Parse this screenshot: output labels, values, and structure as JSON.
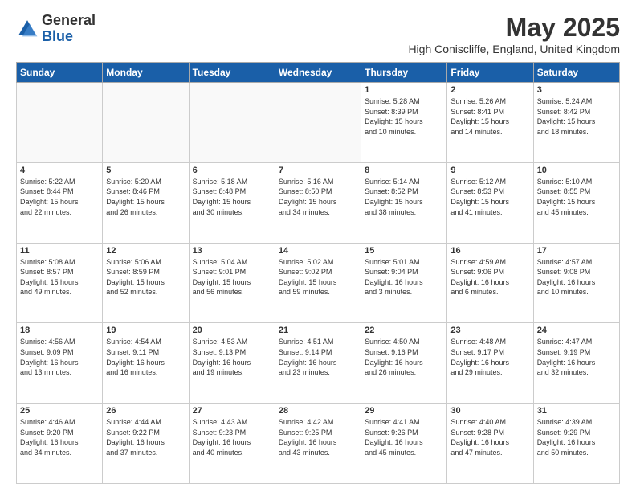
{
  "header": {
    "logo_general": "General",
    "logo_blue": "Blue",
    "month_title": "May 2025",
    "location": "High Coniscliffe, England, United Kingdom"
  },
  "days_of_week": [
    "Sunday",
    "Monday",
    "Tuesday",
    "Wednesday",
    "Thursday",
    "Friday",
    "Saturday"
  ],
  "weeks": [
    [
      {
        "day": "",
        "info": ""
      },
      {
        "day": "",
        "info": ""
      },
      {
        "day": "",
        "info": ""
      },
      {
        "day": "",
        "info": ""
      },
      {
        "day": "1",
        "info": "Sunrise: 5:28 AM\nSunset: 8:39 PM\nDaylight: 15 hours\nand 10 minutes."
      },
      {
        "day": "2",
        "info": "Sunrise: 5:26 AM\nSunset: 8:41 PM\nDaylight: 15 hours\nand 14 minutes."
      },
      {
        "day": "3",
        "info": "Sunrise: 5:24 AM\nSunset: 8:42 PM\nDaylight: 15 hours\nand 18 minutes."
      }
    ],
    [
      {
        "day": "4",
        "info": "Sunrise: 5:22 AM\nSunset: 8:44 PM\nDaylight: 15 hours\nand 22 minutes."
      },
      {
        "day": "5",
        "info": "Sunrise: 5:20 AM\nSunset: 8:46 PM\nDaylight: 15 hours\nand 26 minutes."
      },
      {
        "day": "6",
        "info": "Sunrise: 5:18 AM\nSunset: 8:48 PM\nDaylight: 15 hours\nand 30 minutes."
      },
      {
        "day": "7",
        "info": "Sunrise: 5:16 AM\nSunset: 8:50 PM\nDaylight: 15 hours\nand 34 minutes."
      },
      {
        "day": "8",
        "info": "Sunrise: 5:14 AM\nSunset: 8:52 PM\nDaylight: 15 hours\nand 38 minutes."
      },
      {
        "day": "9",
        "info": "Sunrise: 5:12 AM\nSunset: 8:53 PM\nDaylight: 15 hours\nand 41 minutes."
      },
      {
        "day": "10",
        "info": "Sunrise: 5:10 AM\nSunset: 8:55 PM\nDaylight: 15 hours\nand 45 minutes."
      }
    ],
    [
      {
        "day": "11",
        "info": "Sunrise: 5:08 AM\nSunset: 8:57 PM\nDaylight: 15 hours\nand 49 minutes."
      },
      {
        "day": "12",
        "info": "Sunrise: 5:06 AM\nSunset: 8:59 PM\nDaylight: 15 hours\nand 52 minutes."
      },
      {
        "day": "13",
        "info": "Sunrise: 5:04 AM\nSunset: 9:01 PM\nDaylight: 15 hours\nand 56 minutes."
      },
      {
        "day": "14",
        "info": "Sunrise: 5:02 AM\nSunset: 9:02 PM\nDaylight: 15 hours\nand 59 minutes."
      },
      {
        "day": "15",
        "info": "Sunrise: 5:01 AM\nSunset: 9:04 PM\nDaylight: 16 hours\nand 3 minutes."
      },
      {
        "day": "16",
        "info": "Sunrise: 4:59 AM\nSunset: 9:06 PM\nDaylight: 16 hours\nand 6 minutes."
      },
      {
        "day": "17",
        "info": "Sunrise: 4:57 AM\nSunset: 9:08 PM\nDaylight: 16 hours\nand 10 minutes."
      }
    ],
    [
      {
        "day": "18",
        "info": "Sunrise: 4:56 AM\nSunset: 9:09 PM\nDaylight: 16 hours\nand 13 minutes."
      },
      {
        "day": "19",
        "info": "Sunrise: 4:54 AM\nSunset: 9:11 PM\nDaylight: 16 hours\nand 16 minutes."
      },
      {
        "day": "20",
        "info": "Sunrise: 4:53 AM\nSunset: 9:13 PM\nDaylight: 16 hours\nand 19 minutes."
      },
      {
        "day": "21",
        "info": "Sunrise: 4:51 AM\nSunset: 9:14 PM\nDaylight: 16 hours\nand 23 minutes."
      },
      {
        "day": "22",
        "info": "Sunrise: 4:50 AM\nSunset: 9:16 PM\nDaylight: 16 hours\nand 26 minutes."
      },
      {
        "day": "23",
        "info": "Sunrise: 4:48 AM\nSunset: 9:17 PM\nDaylight: 16 hours\nand 29 minutes."
      },
      {
        "day": "24",
        "info": "Sunrise: 4:47 AM\nSunset: 9:19 PM\nDaylight: 16 hours\nand 32 minutes."
      }
    ],
    [
      {
        "day": "25",
        "info": "Sunrise: 4:46 AM\nSunset: 9:20 PM\nDaylight: 16 hours\nand 34 minutes."
      },
      {
        "day": "26",
        "info": "Sunrise: 4:44 AM\nSunset: 9:22 PM\nDaylight: 16 hours\nand 37 minutes."
      },
      {
        "day": "27",
        "info": "Sunrise: 4:43 AM\nSunset: 9:23 PM\nDaylight: 16 hours\nand 40 minutes."
      },
      {
        "day": "28",
        "info": "Sunrise: 4:42 AM\nSunset: 9:25 PM\nDaylight: 16 hours\nand 43 minutes."
      },
      {
        "day": "29",
        "info": "Sunrise: 4:41 AM\nSunset: 9:26 PM\nDaylight: 16 hours\nand 45 minutes."
      },
      {
        "day": "30",
        "info": "Sunrise: 4:40 AM\nSunset: 9:28 PM\nDaylight: 16 hours\nand 47 minutes."
      },
      {
        "day": "31",
        "info": "Sunrise: 4:39 AM\nSunset: 9:29 PM\nDaylight: 16 hours\nand 50 minutes."
      }
    ]
  ]
}
